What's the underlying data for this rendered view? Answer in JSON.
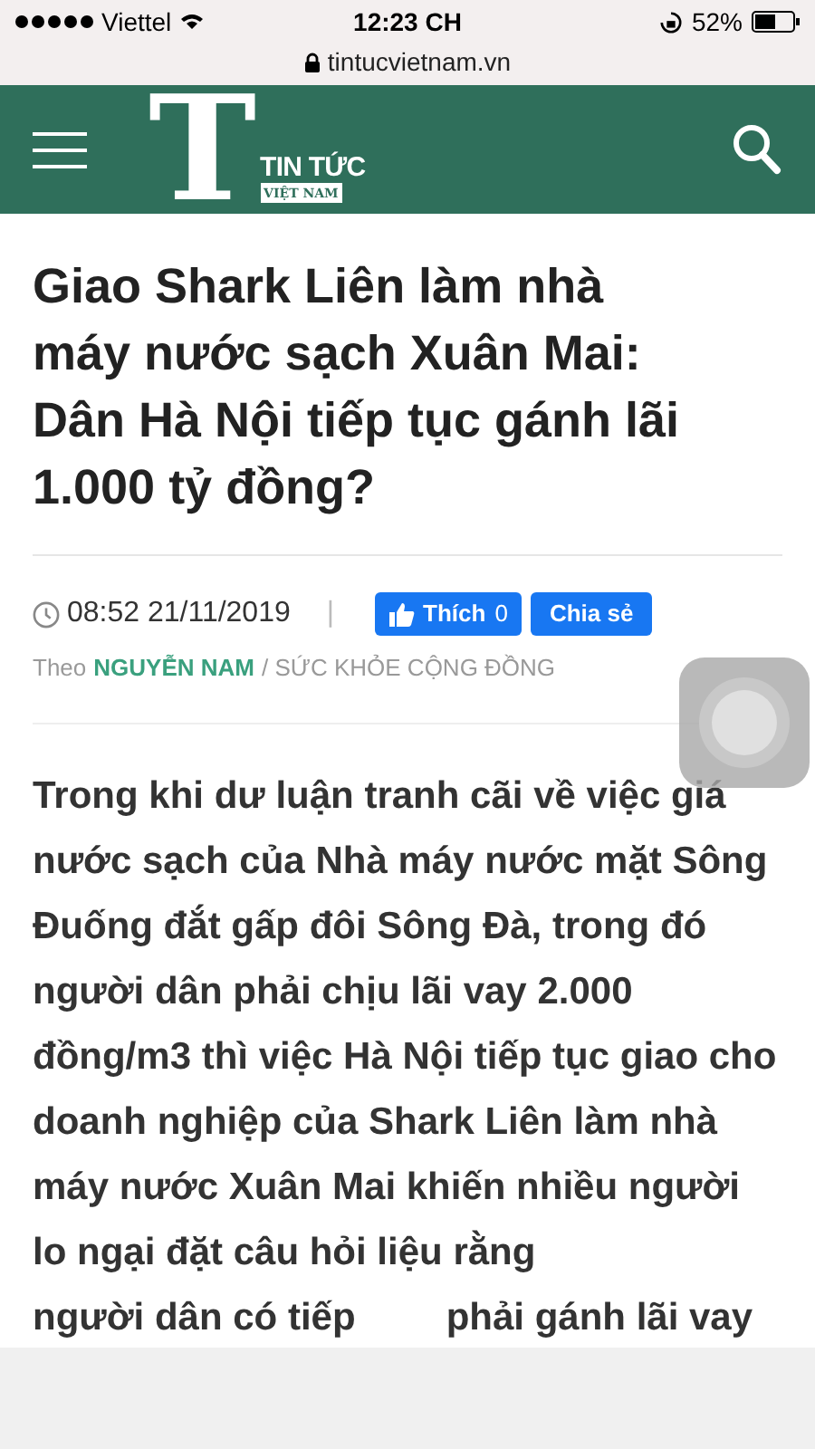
{
  "status_bar": {
    "carrier": "Viettel",
    "time": "12:23 CH",
    "battery": "52%"
  },
  "address_bar": {
    "url": "tintucvietnam.vn"
  },
  "header": {
    "logo_letter": "T",
    "logo_title": "TIN TỨC",
    "logo_subtitle": "VIỆT NAM"
  },
  "article": {
    "title": "Giao Shark Liên làm nhà máy nước sạch Xuân Mai: Dân Hà Nội tiếp tục gánh lãi 1.000 tỷ đồng?",
    "time": "08:52 21/11/2019",
    "separator": "|",
    "like_button": {
      "label": "Thích",
      "count": "0"
    },
    "share_button": {
      "label": "Chia sẻ"
    },
    "byline": {
      "prefix": "Theo",
      "author": "NGUYỄN NAM",
      "category": "/ SỨC KHỎE CỘNG ĐỒNG"
    },
    "lead": "Trong khi dư luận tranh cãi về việc giá nước sạch của Nhà máy nước mặt Sông Đuống đắt gấp đôi Sông Đà, trong đó người dân phải chịu lãi vay 2.000 đồng/m3 thì việc Hà Nội tiếp tục giao cho doanh nghiệp của Shark Liên làm nhà máy nước Xuân Mai khiến nhiều người lo ngại đặt câu hỏi liệu rằng",
    "lead_last_line": [
      "người dân có tiếp",
      "phải gánh lãi vay"
    ]
  }
}
